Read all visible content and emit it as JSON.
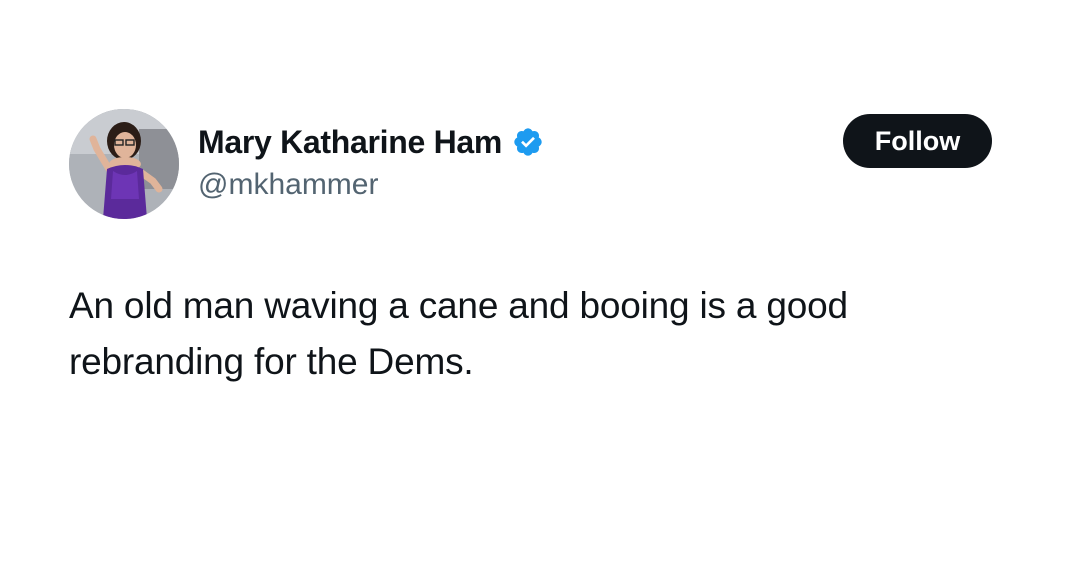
{
  "author": {
    "display_name": "Mary Katharine Ham",
    "handle": "@mkhammer",
    "verified": true,
    "avatar_icon": "profile-photo"
  },
  "actions": {
    "follow_label": "Follow"
  },
  "tweet": {
    "text": "An old man waving a cane and booing is a good rebranding for the Dems."
  },
  "colors": {
    "text_primary": "#0f1419",
    "text_secondary": "#536471",
    "verified_blue": "#1d9bf0",
    "button_bg": "#0f1419",
    "button_text": "#ffffff",
    "background": "#ffffff"
  }
}
